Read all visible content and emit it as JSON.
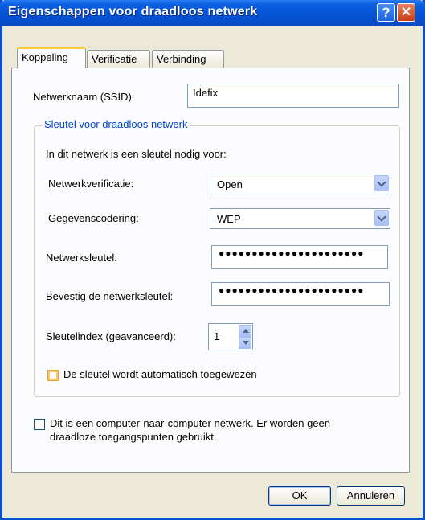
{
  "window": {
    "title": "Eigenschappen voor draadloos netwerk",
    "help": "?",
    "close": "✕"
  },
  "tabs": [
    {
      "label": "Koppeling"
    },
    {
      "label": "Verificatie"
    },
    {
      "label": "Verbinding"
    }
  ],
  "ssid": {
    "label": "Netwerknaam (SSID):",
    "value": "Idefix"
  },
  "group": {
    "title": "Sleutel voor draadloos netwerk",
    "intro": "In dit netwerk is een sleutel nodig voor:",
    "auth_label": "Netwerkverificatie:",
    "auth_value": "Open",
    "enc_label": "Gegevenscodering:",
    "enc_value": "WEP",
    "key_label": "Netwerksleutel:",
    "key_value": "●●●●●●●●●●●●●●●●●●●●●●",
    "confirm_label": "Bevestig de netwerksleutel:",
    "confirm_value": "●●●●●●●●●●●●●●●●●●●●●●",
    "index_label": "Sleutelindex (geavanceerd):",
    "index_value": "1",
    "auto_key_label": "De sleutel wordt automatisch toegewezen",
    "auto_key_checked": false
  },
  "adhoc": {
    "line1": "Dit is een computer-naar-computer netwerk. Er worden geen",
    "line2": "draadloze toegangspunten gebruikt.",
    "checked": false
  },
  "buttons": {
    "ok": "OK",
    "cancel": "Annuleren"
  }
}
